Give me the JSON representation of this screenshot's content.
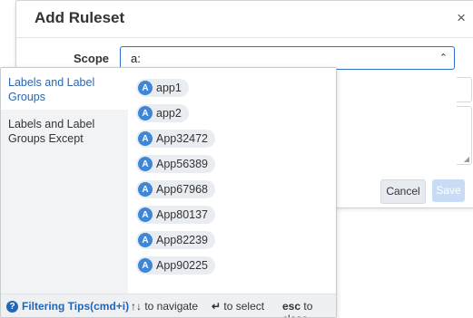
{
  "modal": {
    "title": "Add Ruleset",
    "close_glyph": "×",
    "scope_label": "Scope",
    "scope_value": "a:",
    "chevron_glyph": "⌃",
    "cancel_label": "Cancel",
    "save_label": "Save"
  },
  "dropdown": {
    "categories": [
      {
        "label": "Labels and Label Groups"
      },
      {
        "label": "Labels and Label Groups Except"
      }
    ],
    "options": [
      {
        "icon": "A",
        "label": "app1"
      },
      {
        "icon": "A",
        "label": "app2"
      },
      {
        "icon": "A",
        "label": "App32472"
      },
      {
        "icon": "A",
        "label": "App56389"
      },
      {
        "icon": "A",
        "label": "App67968"
      },
      {
        "icon": "A",
        "label": "App80137"
      },
      {
        "icon": "A",
        "label": "App82239"
      },
      {
        "icon": "A",
        "label": "App90225"
      }
    ],
    "footer": {
      "help_glyph": "?",
      "help_label": "Filtering Tips(cmd+i)",
      "nav_keys": "↑↓",
      "nav_text": "to navigate",
      "select_key": "↵",
      "select_text": "to select",
      "close_key": "esc",
      "close_text": "to close"
    }
  },
  "colors": {
    "accent": "#2366b8",
    "chip_icon": "#3f86d6",
    "chip_bg": "#e9edf1"
  }
}
